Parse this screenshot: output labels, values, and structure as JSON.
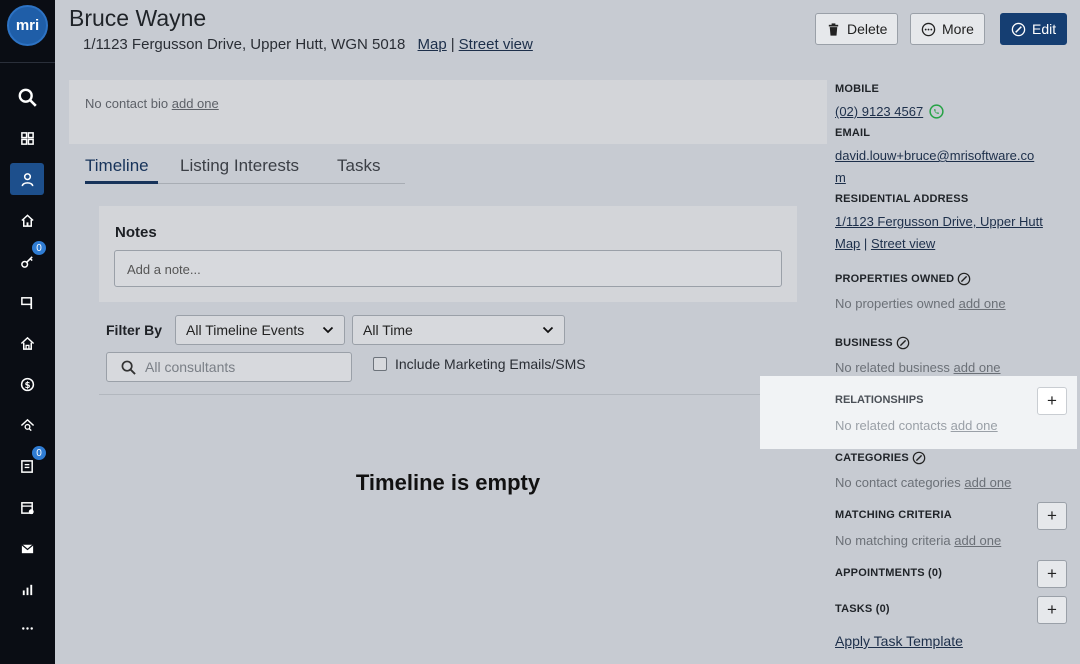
{
  "logo_text": "mri",
  "sidebar": {
    "badges": {
      "keys": "0",
      "tasks": "0"
    }
  },
  "contact": {
    "name": "Bruce Wayne",
    "address": "1/1123 Fergusson Drive, Upper Hutt, WGN 5018",
    "map_link": "Map",
    "separator": "|",
    "street_view_link": "Street view"
  },
  "header_buttons": {
    "delete": "Delete",
    "more": "More",
    "edit": "Edit"
  },
  "bio": {
    "text": "No contact bio",
    "link": "add one"
  },
  "tabs": [
    "Timeline",
    "Listing Interests",
    "Tasks"
  ],
  "notes": {
    "title": "Notes",
    "placeholder": "Add a note..."
  },
  "filter": {
    "label": "Filter By",
    "events_select": "All Timeline Events",
    "time_select": "All Time",
    "consultants_placeholder": "All consultants",
    "include_marketing": "Include Marketing Emails/SMS"
  },
  "timeline_empty": "Timeline is empty",
  "right_panel": {
    "mobile_label": "MOBILE",
    "mobile_value": "(02) 9123 4567",
    "email_label": "EMAIL",
    "email_line1": "david.louw+bruce@mrisoftware.co",
    "email_line2": "m",
    "address_label": "RESIDENTIAL ADDRESS",
    "address_value": "1/1123 Fergusson Drive, Upper Hutt",
    "map_link": "Map",
    "separator": "|",
    "street_view_link": "Street view",
    "properties_label": "PROPERTIES OWNED",
    "properties_text": "No properties owned",
    "business_label": "BUSINESS",
    "business_text": "No related business",
    "relationships_label": "RELATIONSHIPS",
    "relationships_text": "No related contacts",
    "categories_label": "CATEGORIES",
    "categories_text": "No contact categories",
    "matching_label": "MATCHING CRITERIA",
    "matching_text": "No matching criteria",
    "appointments_label": "APPOINTMENTS (0)",
    "tasks_label": "TASKS (0)",
    "apply_template": "Apply Task Template",
    "add_one": "add one",
    "plus": "+"
  },
  "colors": {
    "sidebar_bg": "#0a0d14",
    "primary": "#153e72",
    "whatsapp": "#25a244"
  }
}
